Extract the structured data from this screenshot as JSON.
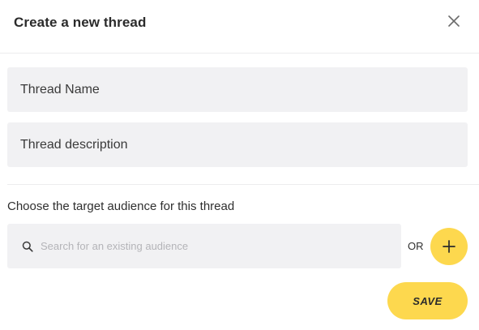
{
  "dialog": {
    "title": "Create a new thread",
    "close_icon": "close-icon"
  },
  "form": {
    "thread_name_placeholder": "Thread Name",
    "thread_description_placeholder": "Thread description",
    "audience_label": "Choose the target audience for this thread",
    "search": {
      "icon": "search-icon",
      "placeholder": "Search for an existing audience",
      "value": ""
    },
    "or_label": "OR",
    "add_audience_icon": "plus-icon",
    "save_label": "SAVE"
  },
  "colors": {
    "accent": "#fdd84e",
    "field_background": "#f1f1f3",
    "divider": "#ececee",
    "text": "#2b2b2b",
    "placeholder": "#b4b4b8"
  }
}
